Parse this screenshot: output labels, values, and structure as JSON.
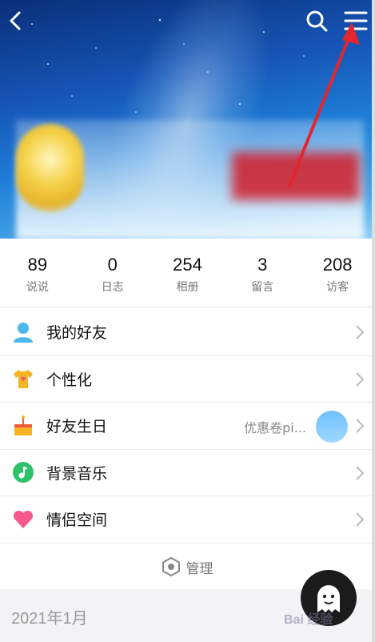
{
  "header": {
    "back_icon": "chevron-left-icon",
    "search_icon": "search-icon",
    "menu_icon": "hamburger-menu-icon"
  },
  "stats": [
    {
      "value": "89",
      "label": "说说"
    },
    {
      "value": "0",
      "label": "日志"
    },
    {
      "value": "254",
      "label": "相册"
    },
    {
      "value": "3",
      "label": "留言"
    },
    {
      "value": "208",
      "label": "访客"
    }
  ],
  "menu": {
    "items": [
      {
        "label": "我的好友",
        "icon": "friend-icon"
      },
      {
        "label": "个性化",
        "icon": "tshirt-icon"
      },
      {
        "label": "好友生日",
        "icon": "birthday-cake-icon",
        "extra": "优惠卷pi..."
      },
      {
        "label": "背景音乐",
        "icon": "music-note-icon"
      },
      {
        "label": "情侣空间",
        "icon": "heart-icon"
      }
    ]
  },
  "manage": {
    "label": "管理",
    "icon": "hexagon-settings-icon"
  },
  "timeline": {
    "date": "2021年1月"
  },
  "watermark": "Bai 经验",
  "colors": {
    "accent": "#1a73e8",
    "arrow": "#e3262d",
    "text_primary": "#111111",
    "text_secondary": "#777777"
  }
}
